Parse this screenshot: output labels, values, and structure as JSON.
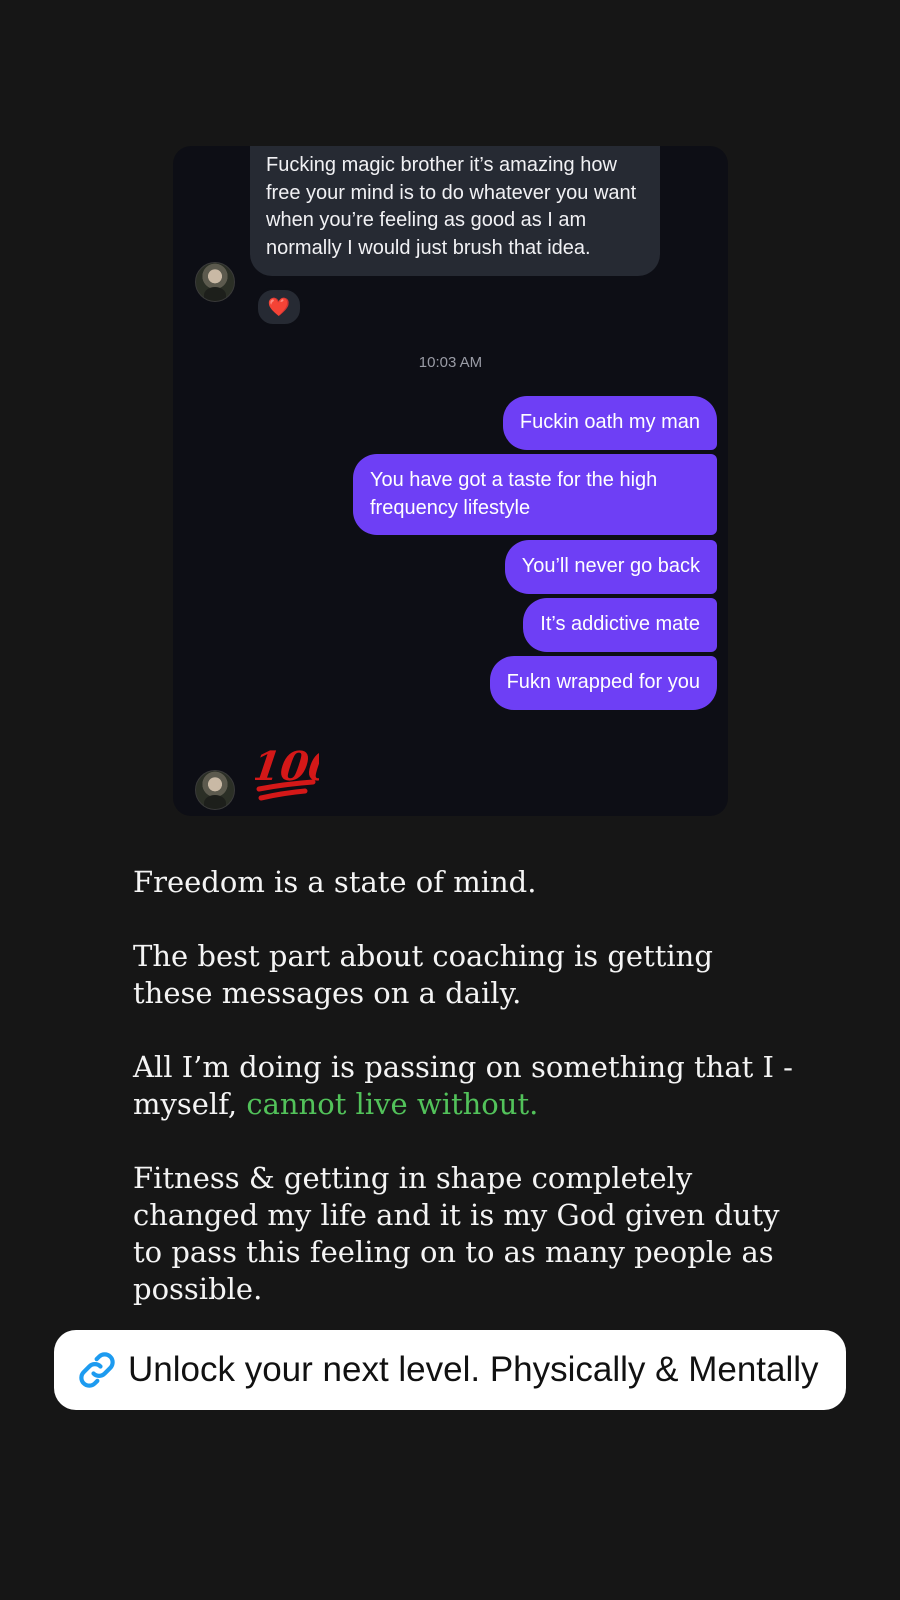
{
  "chat": {
    "incoming_message": "Fucking magic brother it’s amazing how free your mind is to do whatever you want when you’re feeling as good as I am normally I would just brush that idea.",
    "reaction": "❤️",
    "timestamp": "10:03 AM",
    "outgoing_messages": [
      "Fuckin oath my man",
      "You have got a taste for the high frequency lifestyle",
      "You’ll never go back",
      "It’s addictive mate",
      "Fukn wrapped for you"
    ],
    "last_reply_emoji": "100"
  },
  "post": {
    "line1": "Freedom is a state of mind.",
    "line2": "The best part about coaching is getting these messages on a daily.",
    "line3_start": "All I’m doing is passing on something that I - myself, ",
    "line3_highlight": "cannot live without.",
    "line4": "Fitness & getting in shape completely changed my life and it is my God given duty to pass this feeling on to as many people as possible."
  },
  "link_sticker": {
    "label": "Unlock your next level. Physically & Mentally",
    "icon": "link-icon"
  },
  "colors": {
    "background": "#161616",
    "card": "#0d0e15",
    "incoming_bubble": "#262a33",
    "outgoing_bubble": "#6e3ff5",
    "highlight_text": "#52c25a",
    "link_icon": "#1d9bf0"
  }
}
